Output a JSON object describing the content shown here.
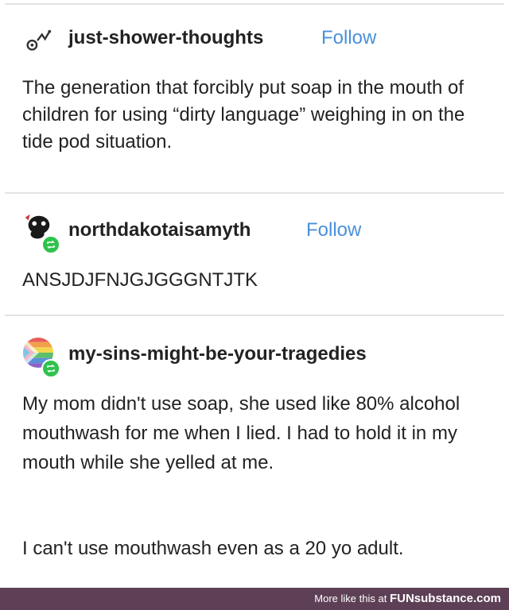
{
  "posts": [
    {
      "username": "just-shower-thoughts",
      "follow_label": "Follow",
      "text": "The generation that forcibly put soap in the mouth of children for using “dirty language” weighing in on the tide pod situation."
    },
    {
      "username": "northdakotaisamyth",
      "follow_label": "Follow",
      "text": "ANSJDJFNJGJGGGNTJTK"
    },
    {
      "username": "my-sins-might-be-your-tragedies",
      "paragraphs": [
        "My mom didn't use soap, she used like 80% alcohol mouthwash for me when I lied. I had to hold it in my mouth while she yelled at me.",
        "I can't use mouthwash even as a 20 yo adult."
      ]
    }
  ],
  "footer": {
    "prefix": "More like this at ",
    "brand": "FUNsubstance.com"
  },
  "colors": {
    "follow": "#4a90d9",
    "reblog": "#2fc24d",
    "footer_bg": "#5e4056"
  }
}
